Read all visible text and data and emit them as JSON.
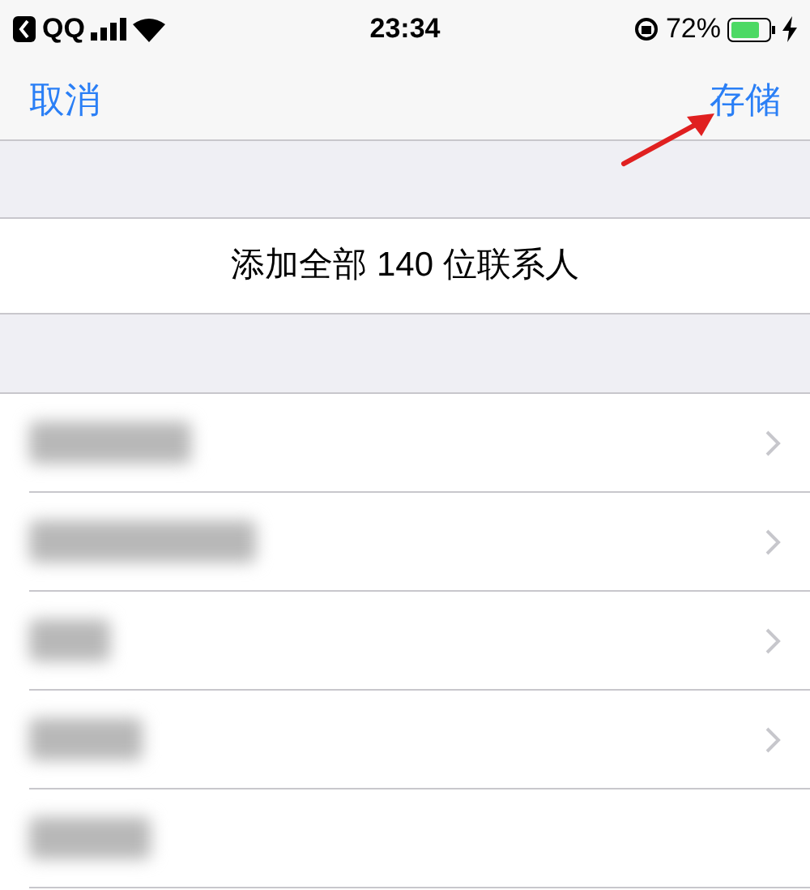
{
  "status_bar": {
    "back_app": "QQ",
    "time": "23:34",
    "battery": "72%"
  },
  "nav": {
    "cancel": "取消",
    "save": "存储"
  },
  "add_all": "添加全部 140 位联系人",
  "contacts": [
    {
      "chevron": true
    },
    {
      "chevron": true
    },
    {
      "chevron": true
    },
    {
      "chevron": true
    },
    {
      "chevron": false
    }
  ]
}
